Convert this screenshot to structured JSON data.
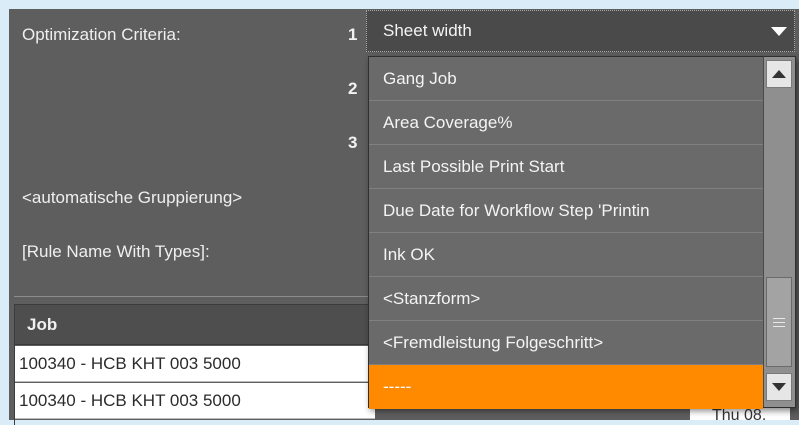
{
  "form": {
    "criteria_label": "Optimization Criteria:",
    "num1": "1",
    "num2": "2",
    "num3": "3",
    "auto_group_label": "<automatische Gruppierung>",
    "rule_name_label": "[Rule Name With Types]:"
  },
  "dropdown": {
    "selected_value": "Sheet width",
    "items": [
      "Gang Job",
      "Area Coverage%",
      "Last Possible Print Start",
      "Due Date for Workflow Step 'Printin",
      "Ink OK",
      "<Stanzform>",
      "<Fremdleistung Folgeschritt>",
      "-----"
    ],
    "highlighted_index": 7
  },
  "table": {
    "header_job": "Job",
    "rows": [
      "100340 - HCB KHT 003 5000",
      "100340 - HCB KHT 003 5000"
    ],
    "right_cell_partial": "Thu 08."
  },
  "colors": {
    "panel_bg": "#5e5e5e",
    "highlight": "#ff8a00"
  }
}
